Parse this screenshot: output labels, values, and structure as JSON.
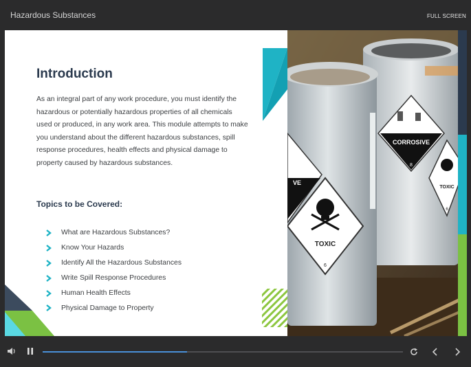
{
  "header": {
    "title": "Hazardous Substances",
    "fullscreen_label": "FULL SCREEN"
  },
  "slide": {
    "heading": "Introduction",
    "body": "As an integral part of any work procedure, you must identify the hazardous or potentially hazardous properties of all chemicals used or produced, in any work area. This module attempts to make you understand about the different hazardous substances, spill response procedures, health effects and physical damage to property caused by hazardous substances.",
    "topics_heading": "Topics to be Covered:",
    "topics": [
      "What are Hazardous Substances?",
      "Know Your Hazards",
      "Identify All the Hazardous Substances",
      "Write Spill Response Procedures",
      "Human Health Effects",
      "Physical Damage to Property"
    ],
    "photo_labels": {
      "corrosive": "CORROSIVE",
      "toxic_front": "TOXIC",
      "toxic_back": "TOXIC",
      "class_front": "6",
      "class_back": "6",
      "class_corrosive": "8",
      "partial_label": "VE"
    }
  },
  "player": {
    "progress": 0.4,
    "icons": [
      "volume-icon",
      "pause-icon",
      "replay-icon",
      "previous-icon",
      "next-icon"
    ]
  },
  "colors": {
    "accent_teal": "#1fb3c5",
    "accent_cyan": "#5ad8e2",
    "accent_green": "#7bc143",
    "navy": "#2b3a4e",
    "progress": "#4a90d9"
  }
}
